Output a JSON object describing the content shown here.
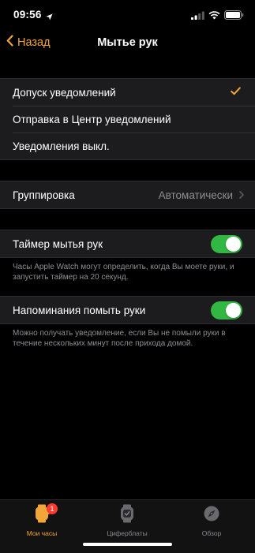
{
  "status_bar": {
    "time": "09:56"
  },
  "nav": {
    "back_label": "Назад",
    "title": "Мытье рук"
  },
  "alerts_section": {
    "items": [
      {
        "label": "Допуск уведомлений",
        "selected": true
      },
      {
        "label": "Отправка в Центр уведомлений",
        "selected": false
      },
      {
        "label": "Уведомления выкл.",
        "selected": false
      }
    ]
  },
  "grouping": {
    "label": "Группировка",
    "value": "Автоматически"
  },
  "timer": {
    "label": "Таймер мытья рук",
    "enabled": true,
    "footer": "Часы Apple Watch могут определить, когда Вы моете руки, и запустить таймер на 20 секунд."
  },
  "reminders": {
    "label": "Напоминания помыть руки",
    "enabled": true,
    "footer": "Можно получать уведомление, если Вы не помыли руки в течение нескольких минут после прихода домой."
  },
  "tab_bar": {
    "items": [
      {
        "label": "Мои часы",
        "icon": "watch-icon",
        "active": true,
        "badge": "1"
      },
      {
        "label": "Циферблаты",
        "icon": "watch-faces-icon",
        "active": false
      },
      {
        "label": "Обзор",
        "icon": "compass-icon",
        "active": false
      }
    ]
  },
  "colors": {
    "accent": "#f2a63a",
    "toggle_on": "#32b842",
    "badge": "#ff3b30"
  }
}
